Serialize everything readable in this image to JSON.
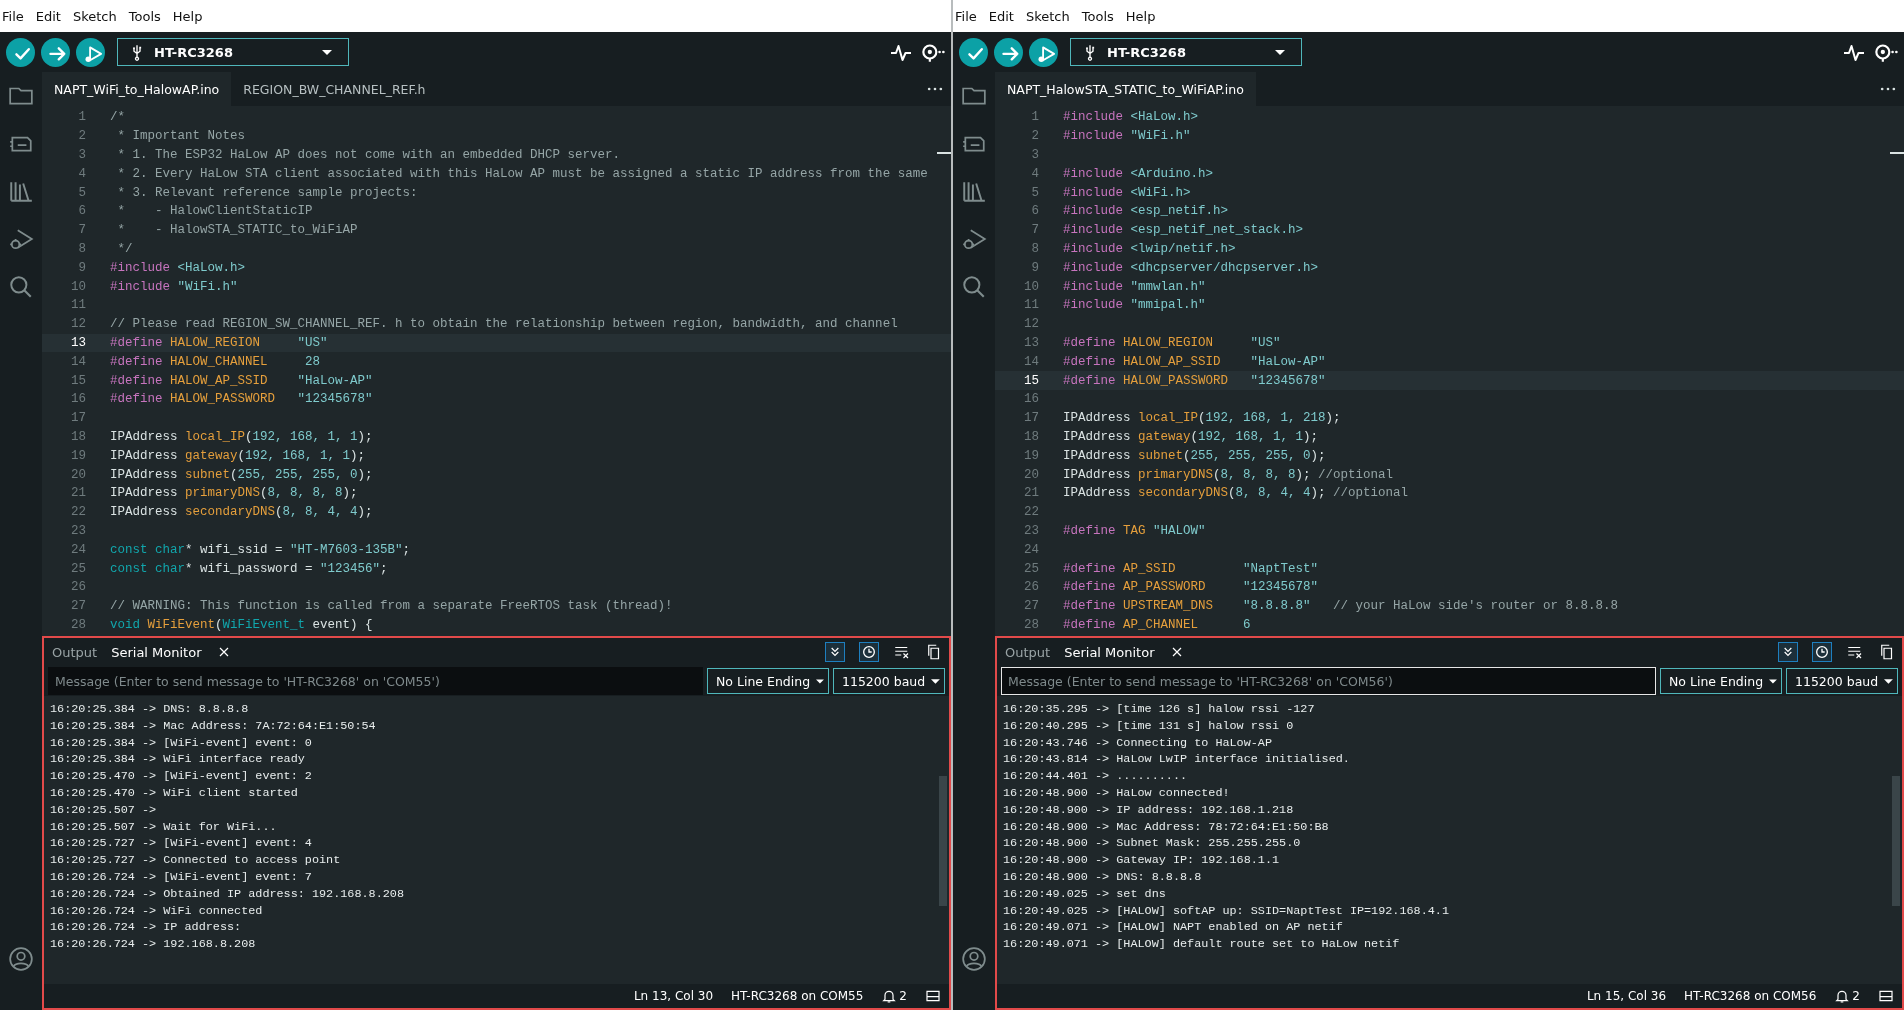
{
  "windows": [
    {
      "menu": [
        "File",
        "Edit",
        "Sketch",
        "Tools",
        "Help"
      ],
      "board": "HT-RC3268",
      "editor_tabs": [
        {
          "label": "NAPT_WiFi_to_HalowAP.ino",
          "selected": true
        },
        {
          "label": "REGION_BW_CHANNEL_REF.h",
          "selected": false
        }
      ],
      "code_lines": [
        {
          "number": "1",
          "current": false,
          "segments": [
            {
              "kind": "comment",
              "text": "/*"
            }
          ]
        },
        {
          "number": "2",
          "current": false,
          "segments": [
            {
              "kind": "comment",
              "text": " * Important Notes"
            }
          ]
        },
        {
          "number": "3",
          "current": false,
          "segments": [
            {
              "kind": "comment",
              "text": " * 1. The ESP32 HaLow AP does not come with an embedded DHCP server."
            }
          ]
        },
        {
          "number": "4",
          "current": false,
          "segments": [
            {
              "kind": "comment",
              "text": " * 2. Every HaLow STA client associated with this HaLow AP must be assigned a static IP address from the same"
            }
          ]
        },
        {
          "number": "5",
          "current": false,
          "segments": [
            {
              "kind": "comment",
              "text": " * 3. Relevant reference sample projects:"
            }
          ]
        },
        {
          "number": "6",
          "current": false,
          "segments": [
            {
              "kind": "comment",
              "text": " *    - HalowClientStaticIP"
            }
          ]
        },
        {
          "number": "7",
          "current": false,
          "segments": [
            {
              "kind": "comment",
              "text": " *    - HalowSTA_STATIC_to_WiFiAP"
            }
          ]
        },
        {
          "number": "8",
          "current": false,
          "segments": [
            {
              "kind": "comment",
              "text": " */"
            }
          ]
        },
        {
          "number": "9",
          "current": false,
          "segments": [
            {
              "kind": "directive",
              "text": "#include "
            },
            {
              "kind": "string",
              "text": "<HaLow.h>"
            }
          ]
        },
        {
          "number": "10",
          "current": false,
          "segments": [
            {
              "kind": "directive",
              "text": "#include "
            },
            {
              "kind": "string",
              "text": "\"WiFi.h\""
            }
          ]
        },
        {
          "number": "11",
          "current": false
        },
        {
          "number": "12",
          "current": false,
          "segments": [
            {
              "kind": "comment",
              "text": "// Please read REGION_SW_CHANNEL_REF. h to obtain the relationship between region, bandwidth, and channel"
            }
          ]
        },
        {
          "number": "13",
          "current": true,
          "segments": [
            {
              "kind": "directive",
              "text": "#define "
            },
            {
              "kind": "name",
              "text": "HALOW_REGION"
            },
            {
              "kind": "string",
              "text": "     \"US\""
            }
          ]
        },
        {
          "number": "14",
          "current": false,
          "segments": [
            {
              "kind": "directive",
              "text": "#define "
            },
            {
              "kind": "name",
              "text": "HALOW_CHANNEL"
            },
            {
              "kind": "number",
              "text": "     28"
            }
          ]
        },
        {
          "number": "15",
          "current": false,
          "segments": [
            {
              "kind": "directive",
              "text": "#define "
            },
            {
              "kind": "name",
              "text": "HALOW_AP_SSID"
            },
            {
              "kind": "string",
              "text": "    \"HaLow-AP\""
            }
          ]
        },
        {
          "number": "16",
          "current": false,
          "segments": [
            {
              "kind": "directive",
              "text": "#define "
            },
            {
              "kind": "name",
              "text": "HALOW_PASSWORD"
            },
            {
              "kind": "string",
              "text": "   \"12345678\""
            }
          ]
        },
        {
          "number": "17",
          "current": false
        },
        {
          "number": "18",
          "current": false,
          "segments": [
            {
              "kind": "plain",
              "text": "IPAddress "
            },
            {
              "kind": "name",
              "text": "local_IP"
            },
            {
              "kind": "plain",
              "text": "("
            },
            {
              "kind": "number",
              "text": "192, 168, 1, 1"
            },
            {
              "kind": "plain",
              "text": ");"
            }
          ]
        },
        {
          "number": "19",
          "current": false,
          "segments": [
            {
              "kind": "plain",
              "text": "IPAddress "
            },
            {
              "kind": "name",
              "text": "gateway"
            },
            {
              "kind": "plain",
              "text": "("
            },
            {
              "kind": "number",
              "text": "192, 168, 1, 1"
            },
            {
              "kind": "plain",
              "text": ");"
            }
          ]
        },
        {
          "number": "20",
          "current": false,
          "segments": [
            {
              "kind": "plain",
              "text": "IPAddress "
            },
            {
              "kind": "name",
              "text": "subnet"
            },
            {
              "kind": "plain",
              "text": "("
            },
            {
              "kind": "number",
              "text": "255, 255, 255, 0"
            },
            {
              "kind": "plain",
              "text": ");"
            }
          ]
        },
        {
          "number": "21",
          "current": false,
          "segments": [
            {
              "kind": "plain",
              "text": "IPAddress "
            },
            {
              "kind": "name",
              "text": "primaryDNS"
            },
            {
              "kind": "plain",
              "text": "("
            },
            {
              "kind": "number",
              "text": "8, 8, 8, 8"
            },
            {
              "kind": "plain",
              "text": ");"
            }
          ]
        },
        {
          "number": "22",
          "current": false,
          "segments": [
            {
              "kind": "plain",
              "text": "IPAddress "
            },
            {
              "kind": "name",
              "text": "secondaryDNS"
            },
            {
              "kind": "plain",
              "text": "("
            },
            {
              "kind": "number",
              "text": "8, 8, 4, 4"
            },
            {
              "kind": "plain",
              "text": ");"
            }
          ]
        },
        {
          "number": "23",
          "current": false
        },
        {
          "number": "24",
          "current": false,
          "segments": [
            {
              "kind": "keyword",
              "text": "const char"
            },
            {
              "kind": "plain",
              "text": "* wifi_ssid = "
            },
            {
              "kind": "string",
              "text": "\"HT-M7603-135B\""
            },
            {
              "kind": "plain",
              "text": ";"
            }
          ]
        },
        {
          "number": "25",
          "current": false,
          "segments": [
            {
              "kind": "keyword",
              "text": "const char"
            },
            {
              "kind": "plain",
              "text": "* wifi_password = "
            },
            {
              "kind": "string",
              "text": "\"123456\""
            },
            {
              "kind": "plain",
              "text": ";"
            }
          ]
        },
        {
          "number": "26",
          "current": false
        },
        {
          "number": "27",
          "current": false,
          "segments": [
            {
              "kind": "comment",
              "text": "// WARNING: This function is called from a separate FreeRTOS task (thread)!"
            }
          ]
        },
        {
          "number": "28",
          "current": false,
          "segments": [
            {
              "kind": "keyword",
              "text": "void "
            },
            {
              "kind": "name",
              "text": "WiFiEvent"
            },
            {
              "kind": "plain",
              "text": "("
            },
            {
              "kind": "keyword",
              "text": "WiFiEvent_t"
            },
            {
              "kind": "plain",
              "text": " event) {"
            }
          ]
        }
      ],
      "serial": {
        "highlighted": true,
        "tabs": [
          {
            "label": "Output",
            "selected": false
          },
          {
            "label": "Serial Monitor",
            "selected": true
          }
        ],
        "message": {
          "placeholder": "Message (Enter to send message to 'HT-RC3268' on 'COM55')",
          "focused": false
        },
        "line_ending": "No Line Ending",
        "baud": "115200 baud",
        "log": [
          "16:20:25.384 -> DNS: 8.8.8.8",
          "16:20:25.384 -> Mac Address: 7A:72:64:E1:50:54",
          "16:20:25.384 -> [WiFi-event] event: 0",
          "16:20:25.384 -> WiFi interface ready",
          "16:20:25.470 -> [WiFi-event] event: 2",
          "16:20:25.470 -> WiFi client started",
          "16:20:25.507 ->",
          "16:20:25.507 -> Wait for WiFi...",
          "16:20:25.727 -> [WiFi-event] event: 4",
          "16:20:25.727 -> Connected to access point",
          "16:20:26.724 -> [WiFi-event] event: 7",
          "16:20:26.724 -> Obtained IP address: 192.168.8.208",
          "16:20:26.724 -> WiFi connected",
          "16:20:26.724 -> IP address:",
          "16:20:26.724 -> 192.168.8.208"
        ]
      },
      "status": {
        "position": "Ln 13, Col 30",
        "port": "HT-RC3268 on COM55",
        "notifications": "2"
      }
    },
    {
      "menu": [
        "File",
        "Edit",
        "Sketch",
        "Tools",
        "Help"
      ],
      "board": "HT-RC3268",
      "editor_tabs": [
        {
          "label": "NAPT_HalowSTA_STATIC_to_WiFiAP.ino",
          "selected": true
        }
      ],
      "code_lines": [
        {
          "number": "1",
          "current": false,
          "segments": [
            {
              "kind": "directive",
              "text": "#include "
            },
            {
              "kind": "string",
              "text": "<HaLow.h>"
            }
          ]
        },
        {
          "number": "2",
          "current": false,
          "segments": [
            {
              "kind": "directive",
              "text": "#include "
            },
            {
              "kind": "string",
              "text": "\"WiFi.h\""
            }
          ]
        },
        {
          "number": "3",
          "current": false
        },
        {
          "number": "4",
          "current": false,
          "segments": [
            {
              "kind": "directive",
              "text": "#include "
            },
            {
              "kind": "string",
              "text": "<Arduino.h>"
            }
          ]
        },
        {
          "number": "5",
          "current": false,
          "segments": [
            {
              "kind": "directive",
              "text": "#include "
            },
            {
              "kind": "string",
              "text": "<WiFi.h>"
            }
          ]
        },
        {
          "number": "6",
          "current": false,
          "segments": [
            {
              "kind": "directive",
              "text": "#include "
            },
            {
              "kind": "string",
              "text": "<esp_netif.h>"
            }
          ]
        },
        {
          "number": "7",
          "current": false,
          "segments": [
            {
              "kind": "directive",
              "text": "#include "
            },
            {
              "kind": "string",
              "text": "<esp_netif_net_stack.h>"
            }
          ]
        },
        {
          "number": "8",
          "current": false,
          "segments": [
            {
              "kind": "directive",
              "text": "#include "
            },
            {
              "kind": "string",
              "text": "<lwip/netif.h>"
            }
          ]
        },
        {
          "number": "9",
          "current": false,
          "segments": [
            {
              "kind": "directive",
              "text": "#include "
            },
            {
              "kind": "string",
              "text": "<dhcpserver/dhcpserver.h>"
            }
          ]
        },
        {
          "number": "10",
          "current": false,
          "segments": [
            {
              "kind": "directive",
              "text": "#include "
            },
            {
              "kind": "string",
              "text": "\"mmwlan.h\""
            }
          ]
        },
        {
          "number": "11",
          "current": false,
          "segments": [
            {
              "kind": "directive",
              "text": "#include "
            },
            {
              "kind": "string",
              "text": "\"mmipal.h\""
            }
          ]
        },
        {
          "number": "12",
          "current": false
        },
        {
          "number": "13",
          "current": false,
          "segments": [
            {
              "kind": "directive",
              "text": "#define "
            },
            {
              "kind": "name",
              "text": "HALOW_REGION"
            },
            {
              "kind": "string",
              "text": "     \"US\""
            }
          ]
        },
        {
          "number": "14",
          "current": false,
          "segments": [
            {
              "kind": "directive",
              "text": "#define "
            },
            {
              "kind": "name",
              "text": "HALOW_AP_SSID"
            },
            {
              "kind": "string",
              "text": "    \"HaLow-AP\""
            }
          ]
        },
        {
          "number": "15",
          "current": true,
          "segments": [
            {
              "kind": "directive",
              "text": "#define "
            },
            {
              "kind": "name",
              "text": "HALOW_PASSWORD"
            },
            {
              "kind": "string",
              "text": "   \"12345678\""
            }
          ]
        },
        {
          "number": "16",
          "current": false
        },
        {
          "number": "17",
          "current": false,
          "segments": [
            {
              "kind": "plain",
              "text": "IPAddress "
            },
            {
              "kind": "name",
              "text": "local_IP"
            },
            {
              "kind": "plain",
              "text": "("
            },
            {
              "kind": "number",
              "text": "192, 168, 1, 218"
            },
            {
              "kind": "plain",
              "text": ");"
            }
          ]
        },
        {
          "number": "18",
          "current": false,
          "segments": [
            {
              "kind": "plain",
              "text": "IPAddress "
            },
            {
              "kind": "name",
              "text": "gateway"
            },
            {
              "kind": "plain",
              "text": "("
            },
            {
              "kind": "number",
              "text": "192, 168, 1, 1"
            },
            {
              "kind": "plain",
              "text": ");"
            }
          ]
        },
        {
          "number": "19",
          "current": false,
          "segments": [
            {
              "kind": "plain",
              "text": "IPAddress "
            },
            {
              "kind": "name",
              "text": "subnet"
            },
            {
              "kind": "plain",
              "text": "("
            },
            {
              "kind": "number",
              "text": "255, 255, 255, 0"
            },
            {
              "kind": "plain",
              "text": ");"
            }
          ]
        },
        {
          "number": "20",
          "current": false,
          "segments": [
            {
              "kind": "plain",
              "text": "IPAddress "
            },
            {
              "kind": "name",
              "text": "primaryDNS"
            },
            {
              "kind": "plain",
              "text": "("
            },
            {
              "kind": "number",
              "text": "8, 8, 8, 8"
            },
            {
              "kind": "plain",
              "text": ");"
            },
            {
              "kind": "comment",
              "text": " //optional"
            }
          ]
        },
        {
          "number": "21",
          "current": false,
          "segments": [
            {
              "kind": "plain",
              "text": "IPAddress "
            },
            {
              "kind": "name",
              "text": "secondaryDNS"
            },
            {
              "kind": "plain",
              "text": "("
            },
            {
              "kind": "number",
              "text": "8, 8, 4, 4"
            },
            {
              "kind": "plain",
              "text": ");"
            },
            {
              "kind": "comment",
              "text": " //optional"
            }
          ]
        },
        {
          "number": "22",
          "current": false
        },
        {
          "number": "23",
          "current": false,
          "segments": [
            {
              "kind": "directive",
              "text": "#define "
            },
            {
              "kind": "name",
              "text": "TAG"
            },
            {
              "kind": "string",
              "text": " \"HALOW\""
            }
          ]
        },
        {
          "number": "24",
          "current": false
        },
        {
          "number": "25",
          "current": false,
          "segments": [
            {
              "kind": "directive",
              "text": "#define "
            },
            {
              "kind": "name",
              "text": "AP_SSID"
            },
            {
              "kind": "string",
              "text": "         \"NaptTest\""
            }
          ]
        },
        {
          "number": "26",
          "current": false,
          "segments": [
            {
              "kind": "directive",
              "text": "#define "
            },
            {
              "kind": "name",
              "text": "AP_PASSWORD"
            },
            {
              "kind": "string",
              "text": "     \"12345678\""
            }
          ]
        },
        {
          "number": "27",
          "current": false,
          "segments": [
            {
              "kind": "directive",
              "text": "#define "
            },
            {
              "kind": "name",
              "text": "UPSTREAM_DNS"
            },
            {
              "kind": "string",
              "text": "    \"8.8.8.8\""
            },
            {
              "kind": "comment",
              "text": "   // your HaLow side's router or 8.8.8.8"
            }
          ]
        },
        {
          "number": "28",
          "current": false,
          "segments": [
            {
              "kind": "directive",
              "text": "#define "
            },
            {
              "kind": "name",
              "text": "AP_CHANNEL"
            },
            {
              "kind": "number",
              "text": "      6"
            }
          ]
        }
      ],
      "serial": {
        "highlighted": true,
        "tabs": [
          {
            "label": "Output",
            "selected": false
          },
          {
            "label": "Serial Monitor",
            "selected": true
          }
        ],
        "message": {
          "placeholder": "Message (Enter to send message to 'HT-RC3268' on 'COM56')",
          "focused": true
        },
        "line_ending": "No Line Ending",
        "baud": "115200 baud",
        "log": [
          "16:20:35.295 -> [time 126 s] halow rssi -127",
          "16:20:40.295 -> [time 131 s] halow rssi 0",
          "16:20:43.746 -> Connecting to HaLow-AP",
          "16:20:43.814 -> HaLow LwIP interface initialised.",
          "16:20:44.401 -> ..........",
          "16:20:48.900 -> HaLow connected!",
          "16:20:48.900 -> IP address: 192.168.1.218",
          "16:20:48.900 -> Mac Address: 78:72:64:E1:50:B8",
          "16:20:48.900 -> Subnet Mask: 255.255.255.0",
          "16:20:48.900 -> Gateway IP: 192.168.1.1",
          "16:20:48.900 -> DNS: 8.8.8.8",
          "16:20:49.025 -> set dns",
          "16:20:49.025 -> [HALOW] softAP up: SSID=NaptTest IP=192.168.4.1",
          "16:20:49.071 -> [HALOW] NAPT enabled on AP netif",
          "16:20:49.071 -> [HALOW] default route set to HaLow netif"
        ]
      },
      "status": {
        "position": "Ln 15, Col 36",
        "port": "HT-RC3268 on COM56",
        "notifications": "2"
      }
    }
  ]
}
